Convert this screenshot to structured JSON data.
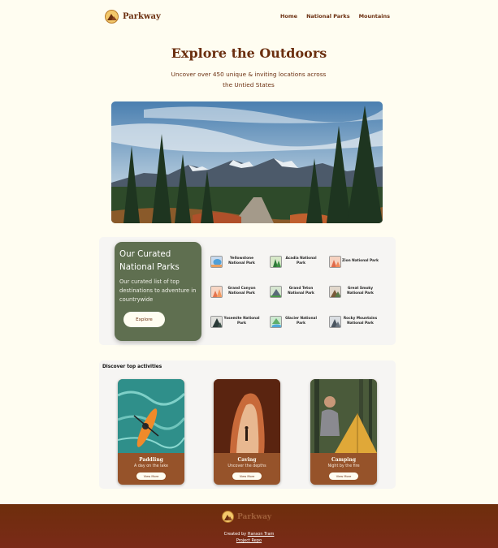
{
  "header": {
    "logo_text": "Parkway",
    "nav": [
      "Home",
      "National Parks",
      "Mountains"
    ]
  },
  "hero": {
    "title": "Explore the Outdoors",
    "subtitle": "Uncover over 450 unique & inviting locations across the Untied States"
  },
  "curated": {
    "title": "Our Curated National Parks",
    "description": "Our curated list of top destinations to adventure in countrywide",
    "button": "Explore",
    "parks": [
      {
        "name": "Yellowstone National Park",
        "icon": "yellowstone-icon"
      },
      {
        "name": "Acadia National Park",
        "icon": "acadia-icon"
      },
      {
        "name": "Zion National Park",
        "icon": "zion-icon"
      },
      {
        "name": "Grand Canyon National Park",
        "icon": "grand-canyon-icon"
      },
      {
        "name": "Grand Teton National Park",
        "icon": "grand-teton-icon"
      },
      {
        "name": "Great Smoky National Park",
        "icon": "great-smoky-icon"
      },
      {
        "name": "Yosemite National Park",
        "icon": "yosemite-icon"
      },
      {
        "name": "Glacier National Park",
        "icon": "glacier-icon"
      },
      {
        "name": "Rocky Mountains National Park",
        "icon": "rocky-mountains-icon"
      }
    ]
  },
  "activities": {
    "title": "Discover top activities",
    "items": [
      {
        "name": "Paddling",
        "desc": "A day on the lake",
        "button": "View More"
      },
      {
        "name": "Caving",
        "desc": "Uncover the depths",
        "button": "View More"
      },
      {
        "name": "Camping",
        "desc": "Night by the fire",
        "button": "View More"
      }
    ]
  },
  "footer": {
    "logo_text": "Parkway",
    "created_by": "Created by",
    "author": "Hanson Tram",
    "repo": "Project Repo"
  },
  "colors": {
    "background": "#FFFDF1",
    "brand_brown": "#6B2F10",
    "curated_green": "#5F6F50",
    "activity_brown": "#96532A"
  }
}
